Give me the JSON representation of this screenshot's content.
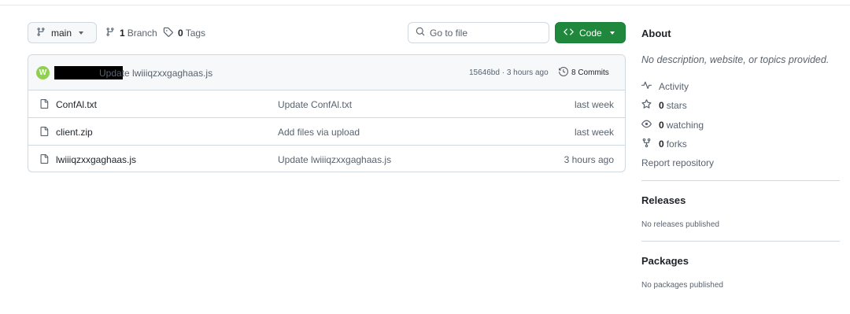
{
  "toolbar": {
    "branch_label": "main",
    "branches_count": "1",
    "branches_label": "Branch",
    "tags_count": "0",
    "tags_label": "Tags",
    "search_placeholder": "Go to file",
    "code_label": "Code"
  },
  "latest_commit": {
    "message": "Update lwiiiqzxxgaghaas.js",
    "hash_time": "15646bd · 3 hours ago",
    "commits_label": "8 Commits"
  },
  "files": [
    {
      "name": "ConfAl.txt",
      "message": "Update ConfAl.txt",
      "time": "last week"
    },
    {
      "name": "client.zip",
      "message": "Add files via upload",
      "time": "last week"
    },
    {
      "name": "lwiiiqzxxgaghaas.js",
      "message": "Update lwiiiqzxxgaghaas.js",
      "time": "3 hours ago"
    }
  ],
  "about": {
    "title": "About",
    "description": "No description, website, or topics provided.",
    "activity": "Activity",
    "stars_count": "0",
    "stars_label": "stars",
    "watching_count": "0",
    "watching_label": "watching",
    "forks_count": "0",
    "forks_label": "forks",
    "report": "Report repository"
  },
  "releases": {
    "title": "Releases",
    "text": "No releases published"
  },
  "packages": {
    "title": "Packages",
    "text": "No packages published"
  },
  "colors": {
    "code_button": "#1f883d",
    "avatar": "#8fd14f",
    "text_muted": "#59636e"
  }
}
